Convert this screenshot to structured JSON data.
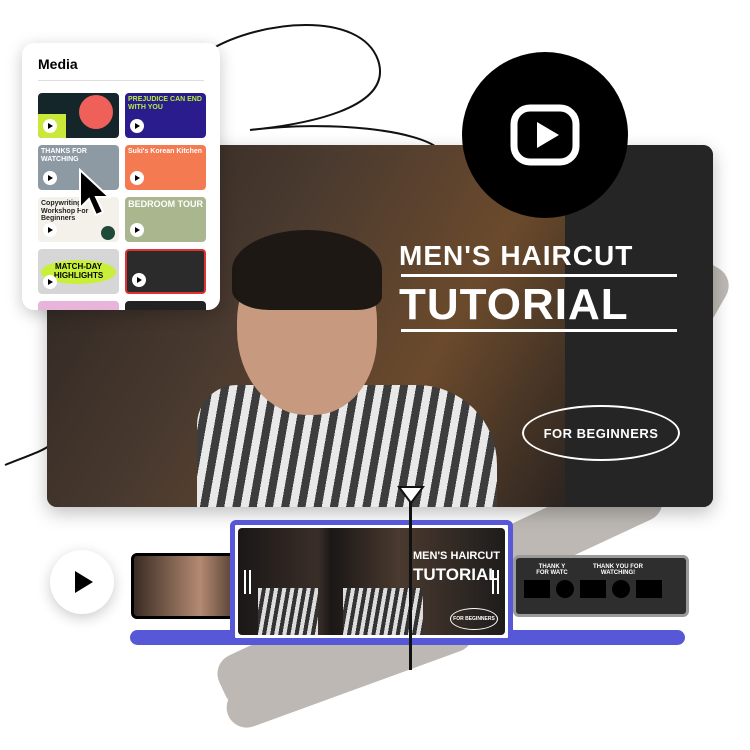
{
  "media_panel": {
    "title": "Media",
    "thumbnails": [
      {
        "text": "",
        "bg": "#14262a"
      },
      {
        "text": "PREJUDICE CAN END WITH YOU",
        "bg": "#2a1c8c"
      },
      {
        "text": "THANKS FOR WATCHING",
        "bg": "#8e9aa3"
      },
      {
        "text": "Suki's Korean Kitchen",
        "bg": "#f47a52"
      },
      {
        "text": "Copywriting Workshop For Beginners",
        "bg": "#f3f1ea"
      },
      {
        "text": "BEDROOM TOUR",
        "bg": "#a9b68e"
      },
      {
        "text": "MATCH-DAY HIGHLIGHTS",
        "bg": "#d6d6d6"
      },
      {
        "text": "",
        "bg": "#2b2b2b"
      }
    ]
  },
  "video": {
    "title_line1": "MEN'S HAIRCUT",
    "title_line2": "TUTORIAL",
    "badge": "FOR BEGINNERS"
  },
  "timeline": {
    "selected_clip": {
      "title_line1": "MEN'S HAIRCUT",
      "title_line2": "TUTORIAL",
      "badge": "FOR BEGINNERS"
    },
    "end_clip_text": "THANK YOU FOR WATCHING!",
    "end_clip_text_partial": "THANK Y FOR WATC"
  },
  "colors": {
    "accent": "#5658d8",
    "brush": "#bdb8b3"
  },
  "icons": [
    "play-icon",
    "cursor-icon",
    "trim-handle-icon"
  ]
}
